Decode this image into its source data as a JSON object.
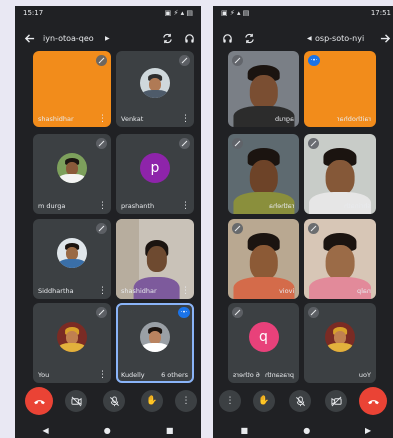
{
  "left_screen": {
    "status_time": "15:17",
    "status_icons": "▣ ⚡ ▴ ▤",
    "meeting_code": "iyn-otoa-qeo",
    "header_icons": {
      "back": "arrow-left-icon",
      "switch_camera": "switch-camera-icon",
      "audio": "headphones-icon"
    },
    "participants": [
      {
        "name": "shashidhar",
        "kind": "orange-tile",
        "mic_muted": true
      },
      {
        "name": "Venkat",
        "kind": "photo",
        "mic_muted": true
      },
      {
        "name": "m durga",
        "kind": "avatar-photo",
        "mic_muted": true
      },
      {
        "name": "prashanth",
        "kind": "letter",
        "letter": "p",
        "avatar_color": "#8e24aa",
        "mic_muted": true
      },
      {
        "name": "Siddhartha",
        "kind": "avatar-photo",
        "mic_muted": true
      },
      {
        "name": "shashidhar",
        "kind": "camera",
        "mic_muted": false
      },
      {
        "name": "You",
        "kind": "avatar-photo",
        "mic_muted": true
      },
      {
        "name": "Kudelly",
        "kind": "avatar-photo",
        "others_label": "6 others",
        "speaking": true
      }
    ],
    "controls": [
      "end-call-icon",
      "camera-off-icon",
      "mic-off-icon",
      "raise-hand-icon",
      "more-vert-icon"
    ],
    "nav": {
      "back": "◀",
      "home": "●",
      "recents": "■"
    }
  },
  "right_screen": {
    "status_time": "17:51",
    "status_icons": "▣ ⚡ ▴ ▤",
    "meeting_code": "osp-soto-nyi",
    "header_icons": {
      "back": "arrow-right-icon",
      "switch_camera": "switch-camera-icon",
      "audio": "headphones-icon"
    },
    "participants": [
      {
        "name": "agrub",
        "kind": "camera",
        "mic_muted": true
      },
      {
        "name": "raithobhar",
        "kind": "orange-tile",
        "speaking": true
      },
      {
        "name": "ratheha",
        "kind": "camera",
        "mic_muted": true
      },
      {
        "name": "shrinath",
        "kind": "camera",
        "mic_muted": true
      },
      {
        "name": "ivoiv",
        "kind": "camera",
        "mic_muted": true
      },
      {
        "name": "nalp",
        "kind": "camera",
        "mic_muted": true
      },
      {
        "name": "prasanth",
        "kind": "letter",
        "letter": "q",
        "avatar_color": "#e8417a",
        "others_label": "6 others",
        "mic_muted": true
      },
      {
        "name": "uoY",
        "kind": "avatar-photo",
        "mic_muted": true
      }
    ],
    "controls": [
      "more-vert-icon",
      "raise-hand-icon",
      "mic-off-icon",
      "camera-off-icon",
      "end-call-icon"
    ],
    "nav": {
      "back": "◀",
      "home": "●",
      "recents": "■"
    }
  }
}
